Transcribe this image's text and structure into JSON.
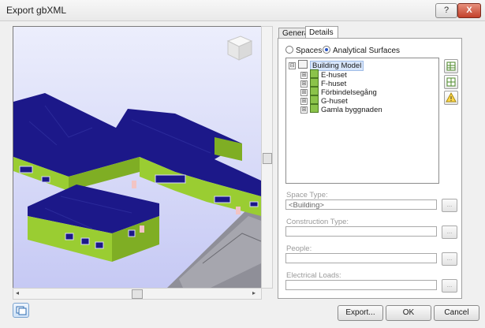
{
  "window": {
    "title": "Export gbXML",
    "help_label": "?",
    "close_label": "X"
  },
  "viewport": {
    "scroll_left_arrow": "◂",
    "scroll_right_arrow": "▸",
    "scroll_up_arrow": "▴",
    "scroll_down_arrow": "▾"
  },
  "tabs": [
    {
      "label": "General",
      "active": false
    },
    {
      "label": "Details",
      "active": true
    }
  ],
  "export_mode": {
    "options": [
      {
        "label": "Spaces",
        "selected": false
      },
      {
        "label": "Analytical Surfaces",
        "selected": true
      }
    ]
  },
  "tree": {
    "root": {
      "label": "Building Model",
      "expander": "⊟"
    },
    "children": [
      {
        "label": "E-huset",
        "expander": "⊞"
      },
      {
        "label": "F-huset",
        "expander": "⊞"
      },
      {
        "label": "Förbindelsegång",
        "expander": "⊞"
      },
      {
        "label": "G-huset",
        "expander": "⊞"
      },
      {
        "label": "Gamla byggnaden",
        "expander": "⊞"
      }
    ]
  },
  "fields": {
    "space_type": {
      "label": "Space Type:",
      "value": "<Building>"
    },
    "construction_type": {
      "label": "Construction Type:",
      "value": ""
    },
    "people": {
      "label": "People:",
      "value": ""
    },
    "electrical_loads": {
      "label": "Electrical Loads:",
      "value": ""
    },
    "browse_label": "..."
  },
  "footer": {
    "export_label": "Export...",
    "ok_label": "OK",
    "cancel_label": "Cancel"
  },
  "colors": {
    "roof": "#1c1889",
    "wall": "#9acd32",
    "window": "#1c1889",
    "ground": "#8f8f98",
    "sky_top": "#eceefc",
    "sky_bottom": "#c6c9f4"
  }
}
